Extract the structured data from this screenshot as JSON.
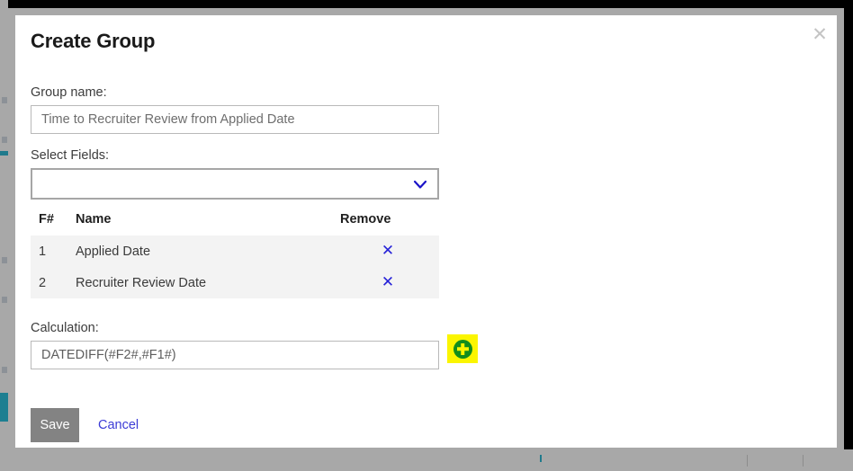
{
  "modal": {
    "title": "Create Group",
    "close_label": "✕"
  },
  "group_name": {
    "label": "Group name:",
    "value": "Time to Recruiter Review from Applied Date",
    "placeholder": "Time to Recruiter Review from Applied Date"
  },
  "select_fields": {
    "label": "Select Fields:",
    "selected_value": "",
    "chevron_icon": "chevron-down-icon"
  },
  "fields_table": {
    "columns": [
      "F#",
      "Name",
      "Remove"
    ],
    "rows": [
      {
        "fnum": "1",
        "name": "Applied Date",
        "remove_icon": "✕"
      },
      {
        "fnum": "2",
        "name": "Recruiter Review Date",
        "remove_icon": "✕"
      }
    ]
  },
  "calculation": {
    "label": "Calculation:",
    "value": "DATEDIFF(#F2#,#F1#)",
    "placeholder": "DATEDIFF(#F2#,#F1#)",
    "add_button_icon": "plus-circle-icon"
  },
  "actions": {
    "save_label": "Save",
    "cancel_label": "Cancel"
  },
  "colors": {
    "accent_blue": "#2622d8",
    "link_blue": "#3b3bd6",
    "save_gray": "#838383",
    "highlight_yellow": "#fbf500",
    "plus_green": "#128d1c",
    "row_gray": "#f3f3f3",
    "modal_border": "#a8a8a8",
    "background_teal": "#1f7a8c"
  }
}
